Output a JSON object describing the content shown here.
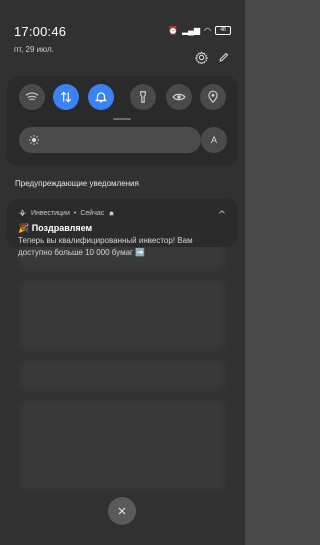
{
  "status": {
    "time": "17:00:46",
    "date": "пт, 29 июл.",
    "battery": "48"
  },
  "quick_settings": {
    "tiles": [
      {
        "name": "wifi-icon",
        "on": false
      },
      {
        "name": "mobile-data-icon",
        "on": true
      },
      {
        "name": "bell-icon",
        "on": true
      },
      {
        "name": "flashlight-icon",
        "on": false
      },
      {
        "name": "eye-icon",
        "on": false
      },
      {
        "name": "location-icon",
        "on": false
      }
    ],
    "auto_label": "A"
  },
  "section_title": "Предупреждающие уведомления",
  "notification": {
    "app": "Инвестиции",
    "time": "Сейчас",
    "title": "🎉 Поздравляем",
    "body": "Теперь вы квалифицированный инвестор! Вам доступно больше 10 000 бумаг ➡️"
  },
  "colors": {
    "accent": "#3b82f6",
    "panel": "#2a2a2a"
  }
}
